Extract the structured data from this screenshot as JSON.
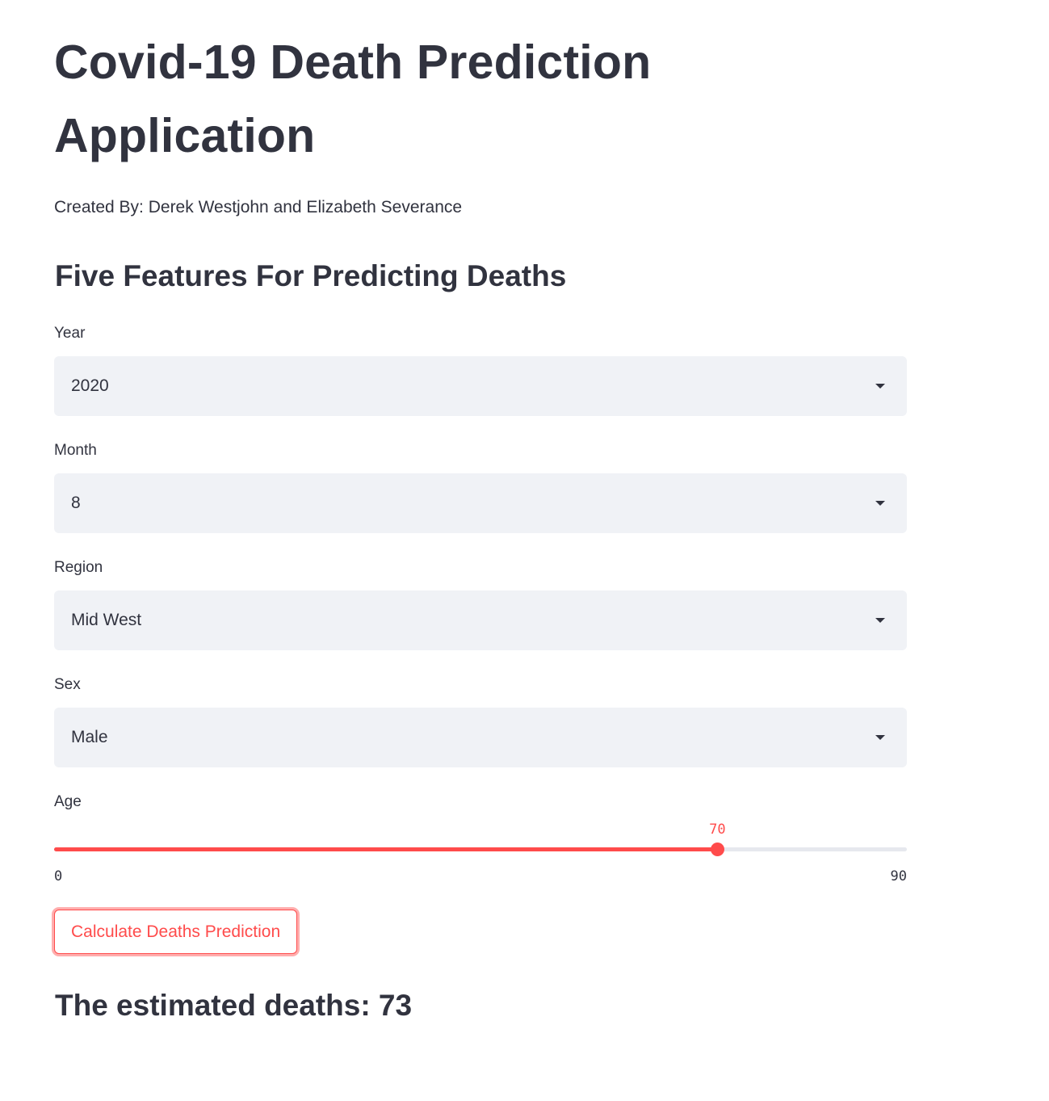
{
  "page": {
    "title": "Covid-19 Death Prediction Application",
    "byline": "Created By: Derek Westjohn and Elizabeth Severance",
    "subheader": "Five Features For Predicting Deaths"
  },
  "fields": {
    "year": {
      "label": "Year",
      "value": "2020"
    },
    "month": {
      "label": "Month",
      "value": "8"
    },
    "region": {
      "label": "Region",
      "value": "Mid West"
    },
    "sex": {
      "label": "Sex",
      "value": "Male"
    }
  },
  "age_slider": {
    "label": "Age",
    "value": 70,
    "value_text": "70",
    "min": 0,
    "min_text": "0",
    "max": 90,
    "max_text": "90"
  },
  "actions": {
    "calculate_label": "Calculate Deaths Prediction"
  },
  "result": {
    "text": "The estimated deaths: 73"
  },
  "theme": {
    "accent": "#ff4b4b",
    "text": "#31333f",
    "input_bg": "#f0f2f6",
    "track": "#e6e8ee"
  }
}
